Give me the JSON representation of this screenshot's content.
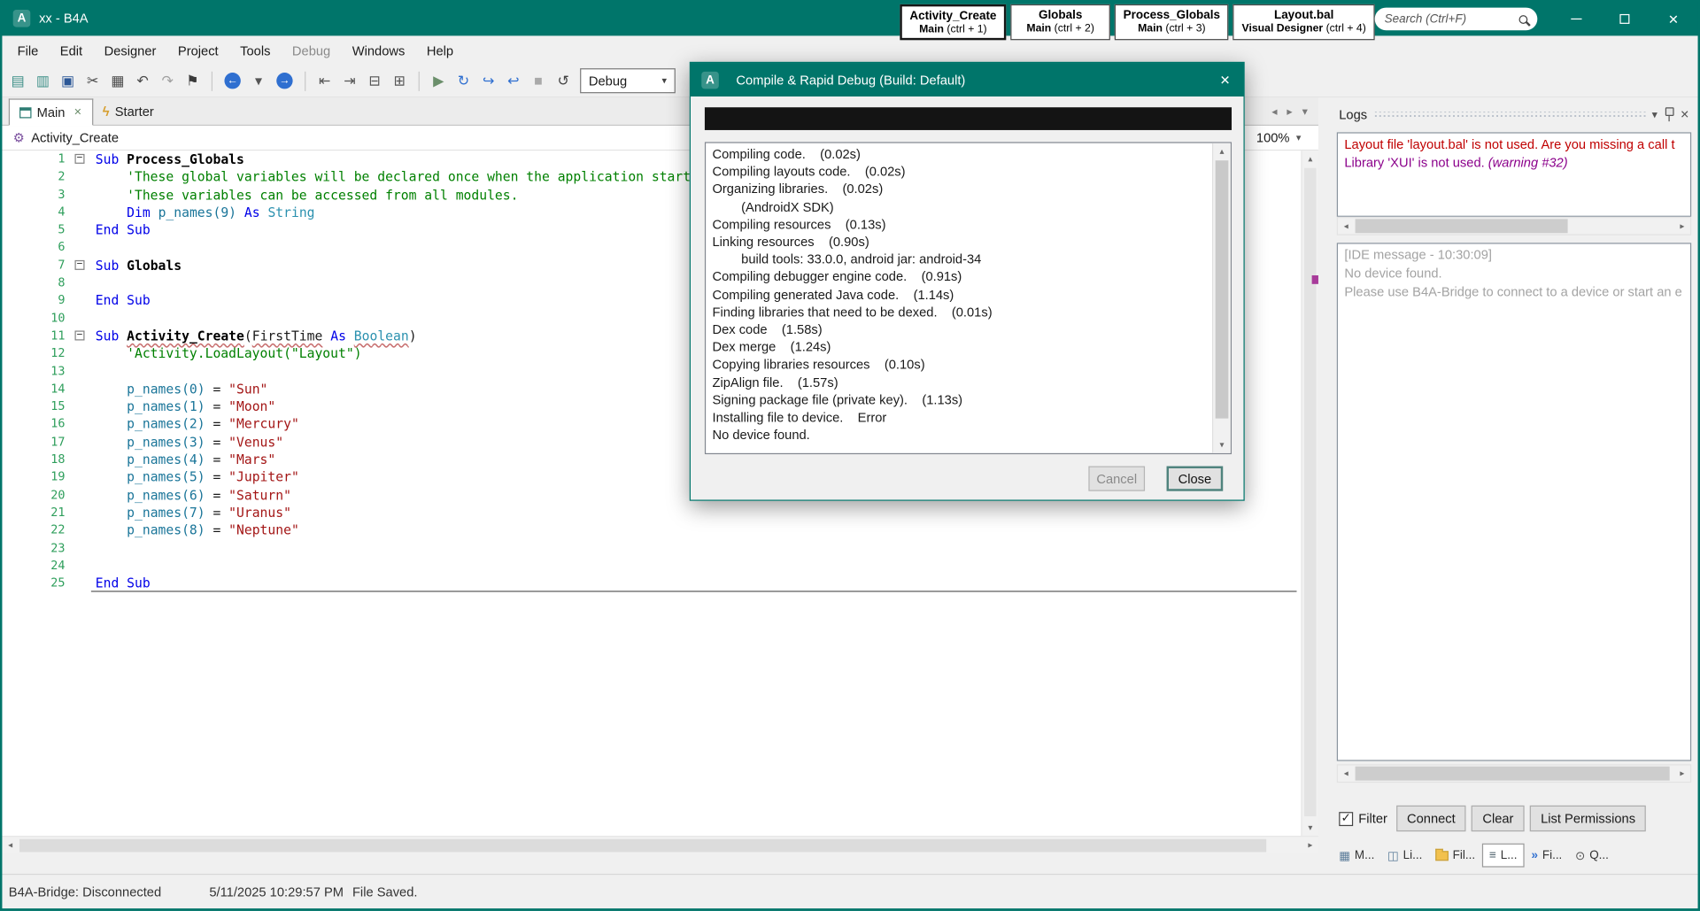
{
  "window": {
    "title": "xx - B4A",
    "logo": "A"
  },
  "search": {
    "placeholder": "Search (Ctrl+F)"
  },
  "quick_tabs": [
    {
      "title": "Activity_Create",
      "subtitle": "Main",
      "hint": "(ctrl + 1)",
      "active": true
    },
    {
      "title": "Globals",
      "subtitle": "Main",
      "hint": "(ctrl + 2)",
      "active": false
    },
    {
      "title": "Process_Globals",
      "subtitle": "Main",
      "hint": "(ctrl + 3)",
      "active": false
    },
    {
      "title": "Layout.bal",
      "subtitle": "Visual Designer",
      "hint": "(ctrl + 4)",
      "active": false
    }
  ],
  "menu": [
    {
      "label": "File"
    },
    {
      "label": "Edit"
    },
    {
      "label": "Designer"
    },
    {
      "label": "Project"
    },
    {
      "label": "Tools"
    },
    {
      "label": "Debug",
      "muted": true
    },
    {
      "label": "Windows"
    },
    {
      "label": "Help"
    }
  ],
  "toolbar": {
    "build_config": "Debug",
    "items": [
      {
        "name": "paste-icon",
        "glyph": "▤",
        "color": "#3b8e86"
      },
      {
        "name": "new-module-icon",
        "glyph": "▥",
        "color": "#3b8e86"
      },
      {
        "name": "save-icon",
        "glyph": "▣",
        "color": "#2b5797"
      },
      {
        "name": "cut-icon",
        "glyph": "✂",
        "color": "#4a4a4a"
      },
      {
        "name": "copy-icon",
        "glyph": "▦",
        "color": "#4a4a4a"
      },
      {
        "name": "undo-icon",
        "glyph": "↶",
        "color": "#4a4a4a"
      },
      {
        "name": "redo-icon",
        "glyph": "↷",
        "color": "#a0a0a0"
      },
      {
        "name": "bookmark-icon",
        "glyph": "⚑",
        "color": "#3a3a3a"
      },
      {
        "sep": true
      },
      {
        "name": "navigate-back-icon",
        "glyph": "←",
        "color": "#ffffff",
        "bg": "#2f6fd0",
        "circle": true
      },
      {
        "name": "navigate-history-icon",
        "glyph": "▾",
        "color": "#555555"
      },
      {
        "name": "navigate-forward-icon",
        "glyph": "→",
        "color": "#ffffff",
        "bg": "#2f6fd0",
        "circle": true
      },
      {
        "sep": true
      },
      {
        "name": "outdent-icon",
        "glyph": "⇤",
        "color": "#555555"
      },
      {
        "name": "indent-icon",
        "glyph": "⇥",
        "color": "#555555"
      },
      {
        "name": "comment-icon",
        "glyph": "⊟",
        "color": "#555555"
      },
      {
        "name": "uncomment-icon",
        "glyph": "⊞",
        "color": "#555555"
      },
      {
        "sep": true
      },
      {
        "name": "run-icon",
        "glyph": "▶",
        "color": "#6b8f6b"
      },
      {
        "name": "step-over-icon",
        "glyph": "↻",
        "color": "#2f6fd0"
      },
      {
        "name": "step-into-icon",
        "glyph": "↪",
        "color": "#2f6fd0"
      },
      {
        "name": "step-out-icon",
        "glyph": "↩",
        "color": "#2f6fd0"
      },
      {
        "name": "stop-icon",
        "glyph": "■",
        "color": "#a9a9a9"
      },
      {
        "name": "restart-icon",
        "glyph": "↺",
        "color": "#444444"
      }
    ]
  },
  "doc_tabs": [
    {
      "label": "Main",
      "icon": "form-icon",
      "glyph": "",
      "closable": true,
      "active": true
    },
    {
      "label": "Starter",
      "icon": "lightning-icon",
      "glyph": "ϟ",
      "closable": false,
      "active": false
    }
  ],
  "breadcrumb": {
    "module": "Activity_Create",
    "zoom": "100%"
  },
  "editor": {
    "lines": [
      {
        "n": 1,
        "fold": true,
        "t": [
          {
            "c": "kw",
            "t": "Sub"
          },
          {
            "c": "pl",
            "t": " "
          },
          {
            "c": "b",
            "t": "Process_Globals"
          }
        ]
      },
      {
        "n": 2,
        "t": [
          {
            "c": "cm",
            "t": "    'These global variables will be declared once when the application starts."
          }
        ]
      },
      {
        "n": 3,
        "t": [
          {
            "c": "cm",
            "t": "    'These variables can be accessed from all modules."
          }
        ]
      },
      {
        "n": 4,
        "t": [
          {
            "c": "pl",
            "t": "    "
          },
          {
            "c": "kw",
            "t": "Dim"
          },
          {
            "c": "pl",
            "t": " "
          },
          {
            "c": "var",
            "t": "p_names(9)"
          },
          {
            "c": "pl",
            "t": " "
          },
          {
            "c": "kw",
            "t": "As"
          },
          {
            "c": "pl",
            "t": " "
          },
          {
            "c": "typ",
            "t": "String"
          }
        ]
      },
      {
        "n": 5,
        "t": [
          {
            "c": "kw",
            "t": "End Sub"
          }
        ]
      },
      {
        "n": 6,
        "t": []
      },
      {
        "n": 7,
        "fold": true,
        "t": [
          {
            "c": "kw",
            "t": "Sub"
          },
          {
            "c": "pl",
            "t": " "
          },
          {
            "c": "b",
            "t": "Globals"
          }
        ]
      },
      {
        "n": 8,
        "t": []
      },
      {
        "n": 9,
        "t": [
          {
            "c": "kw",
            "t": "End Sub"
          }
        ]
      },
      {
        "n": 10,
        "t": []
      },
      {
        "n": 11,
        "fold": true,
        "t": [
          {
            "c": "kw",
            "t": "Sub"
          },
          {
            "c": "pl",
            "t": " "
          },
          {
            "c": "b sq",
            "t": "Activity_Create"
          },
          {
            "c": "pl",
            "t": "("
          },
          {
            "c": "pl sq",
            "t": "FirstTime"
          },
          {
            "c": "pl",
            "t": " "
          },
          {
            "c": "kw",
            "t": "As"
          },
          {
            "c": "pl",
            "t": " "
          },
          {
            "c": "typ sq",
            "t": "Boolean"
          },
          {
            "c": "pl",
            "t": ")"
          }
        ]
      },
      {
        "n": 12,
        "t": [
          {
            "c": "cm",
            "t": "    'Activity.LoadLayout(\"Layout\")"
          }
        ]
      },
      {
        "n": 13,
        "t": []
      },
      {
        "n": 14,
        "t": [
          {
            "c": "pl",
            "t": "    "
          },
          {
            "c": "var",
            "t": "p_names(0)"
          },
          {
            "c": "pl",
            "t": " = "
          },
          {
            "c": "str",
            "t": "\"Sun\""
          }
        ]
      },
      {
        "n": 15,
        "t": [
          {
            "c": "pl",
            "t": "    "
          },
          {
            "c": "var",
            "t": "p_names(1)"
          },
          {
            "c": "pl",
            "t": " = "
          },
          {
            "c": "str",
            "t": "\"Moon\""
          }
        ]
      },
      {
        "n": 16,
        "t": [
          {
            "c": "pl",
            "t": "    "
          },
          {
            "c": "var",
            "t": "p_names(2)"
          },
          {
            "c": "pl",
            "t": " = "
          },
          {
            "c": "str",
            "t": "\"Mercury\""
          }
        ]
      },
      {
        "n": 17,
        "t": [
          {
            "c": "pl",
            "t": "    "
          },
          {
            "c": "var",
            "t": "p_names(3)"
          },
          {
            "c": "pl",
            "t": " = "
          },
          {
            "c": "str",
            "t": "\"Venus\""
          }
        ]
      },
      {
        "n": 18,
        "t": [
          {
            "c": "pl",
            "t": "    "
          },
          {
            "c": "var",
            "t": "p_names(4)"
          },
          {
            "c": "pl",
            "t": " = "
          },
          {
            "c": "str",
            "t": "\"Mars\""
          }
        ]
      },
      {
        "n": 19,
        "t": [
          {
            "c": "pl",
            "t": "    "
          },
          {
            "c": "var",
            "t": "p_names(5)"
          },
          {
            "c": "pl",
            "t": " = "
          },
          {
            "c": "str",
            "t": "\"Jupiter\""
          }
        ]
      },
      {
        "n": 20,
        "t": [
          {
            "c": "pl",
            "t": "    "
          },
          {
            "c": "var",
            "t": "p_names(6)"
          },
          {
            "c": "pl",
            "t": " = "
          },
          {
            "c": "str",
            "t": "\"Saturn\""
          }
        ]
      },
      {
        "n": 21,
        "t": [
          {
            "c": "pl",
            "t": "    "
          },
          {
            "c": "var",
            "t": "p_names(7)"
          },
          {
            "c": "pl",
            "t": " = "
          },
          {
            "c": "str",
            "t": "\"Uranus\""
          }
        ]
      },
      {
        "n": 22,
        "t": [
          {
            "c": "pl",
            "t": "    "
          },
          {
            "c": "var",
            "t": "p_names(8)"
          },
          {
            "c": "pl",
            "t": " = "
          },
          {
            "c": "str",
            "t": "\"Neptune\""
          }
        ]
      },
      {
        "n": 23,
        "t": []
      },
      {
        "n": 24,
        "t": []
      },
      {
        "n": 25,
        "caret": true,
        "t": [
          {
            "c": "kw",
            "t": "End Sub"
          }
        ]
      }
    ]
  },
  "dialog": {
    "title": "Compile & Rapid Debug (Build: Default)",
    "cancel_label": "Cancel",
    "close_label": "Close",
    "log_lines": [
      "Compiling code.    (0.02s)",
      "Compiling layouts code.    (0.02s)",
      "Organizing libraries.    (0.02s)",
      "        (AndroidX SDK)",
      "Compiling resources    (0.13s)",
      "Linking resources    (0.90s)",
      "        build tools: 33.0.0, android jar: android-34",
      "Compiling debugger engine code.    (0.91s)",
      "Compiling generated Java code.    (1.14s)",
      "Finding libraries that need to be dexed.    (0.01s)",
      "Dex code    (1.58s)",
      "Dex merge    (1.24s)",
      "Copying libraries resources    (0.10s)",
      "ZipAlign file.    (1.57s)",
      "Signing package file (private key).    (1.13s)",
      "Installing file to device.    Error",
      "No device found."
    ]
  },
  "logs_panel": {
    "title": "Logs",
    "filter_label": "Filter",
    "filter_checked": true,
    "warnings": [
      {
        "color": "#c00000",
        "parts": [
          {
            "t": "Layout file 'layout.bal' is not used. Are you missing a call t"
          }
        ]
      },
      {
        "color": "#8b008b",
        "parts": [
          {
            "t": "Library 'XUI' is not used. "
          },
          {
            "t": "(warning #32)",
            "italic": true
          }
        ]
      }
    ],
    "messages": [
      "[IDE message - 10:30:09]",
      "No device found.",
      "Please use B4A-Bridge to connect to a device or start an e"
    ],
    "buttons": [
      {
        "name": "connect-button",
        "label": "Connect"
      },
      {
        "name": "clear-button",
        "label": "Clear"
      },
      {
        "name": "list-permissions-button",
        "label": "List Permissions"
      }
    ],
    "bottom_tabs": [
      {
        "name": "modules",
        "label": "M...",
        "icon": "modules-icon",
        "active": false
      },
      {
        "name": "libraries",
        "label": "Li...",
        "icon": "libraries-icon",
        "active": false
      },
      {
        "name": "files",
        "label": "Fil...",
        "icon": "files-icon",
        "active": false
      },
      {
        "name": "logs",
        "label": "L...",
        "icon": "logs-icon",
        "active": true
      },
      {
        "name": "find-all-references",
        "label": "Fi...",
        "icon": "find-icon",
        "active": false
      },
      {
        "name": "quick-search",
        "label": "Q...",
        "icon": "search-glyph-icon",
        "active": false
      }
    ]
  },
  "status_bar": {
    "bridge": "B4A-Bridge: Disconnected",
    "timestamp": "5/11/2025 10:29:57 PM",
    "saved": "File Saved."
  },
  "colors": {
    "accent_teal": "#00756a",
    "keyword": "#0000e8",
    "comment": "#008000",
    "string": "#a31515",
    "variable": "#1a7599",
    "type": "#2b91af",
    "line_number": "#2e9e5b",
    "warning_red": "#c00000",
    "warning_purple": "#8b008b",
    "muted_text": "#a3a3a3",
    "progress_black": "#141414"
  }
}
